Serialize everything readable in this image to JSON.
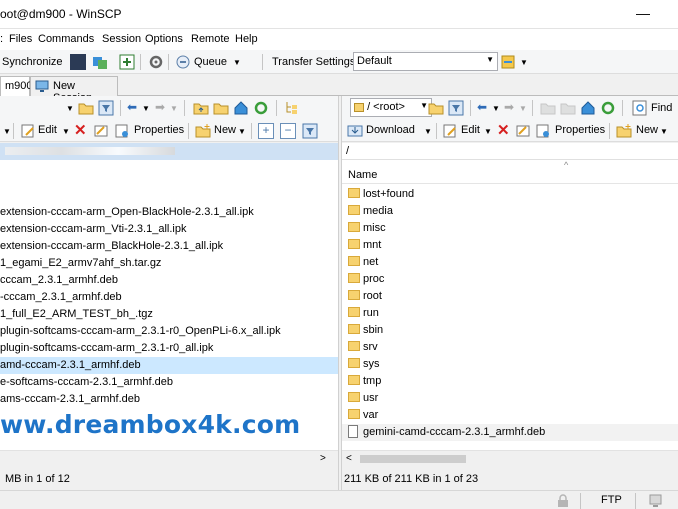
{
  "window": {
    "title": "oot@dm900 - WinSCP",
    "minimize_glyph": "—"
  },
  "menu": [
    "Files",
    "Commands",
    "Session",
    "Options",
    "Remote",
    "Help"
  ],
  "toolbar": {
    "synchronize": "Synchronize",
    "queue": "Queue",
    "transfer_settings_label": "Transfer Settings",
    "transfer_settings_value": "Default"
  },
  "tabs": {
    "session": "m900",
    "new_session": "New Session"
  },
  "left_pane": {
    "edit": "Edit",
    "properties": "Properties",
    "new": "New",
    "files": [
      "",
      "extension-cccam-arm_Open-BlackHole-2.3.1_all.ipk",
      "extension-cccam-arm_Vti-2.3.1_all.ipk",
      "extension-cccam-arm_BlackHole-2.3.1_all.ipk",
      "1_egami_E2_armv7ahf_sh.tar.gz",
      "cccam_2.3.1_armhf.deb",
      "-cccam_2.3.1_armhf.deb",
      "1_full_E2_ARM_TEST_bh_.tgz",
      "plugin-softcams-cccam-arm_2.3.1-r0_OpenPLi-6.x_all.ipk",
      "plugin-softcams-cccam-arm_2.3.1-r0_all.ipk",
      "amd-cccam-2.3.1_armhf.deb",
      "e-softcams-cccam-2.3.1_armhf.deb",
      "ams-cccam-2.3.1_armhf.deb"
    ],
    "status": "MB in 1 of 12"
  },
  "right_pane": {
    "path": "/ <root>",
    "find": "Find",
    "download": "Download",
    "edit": "Edit",
    "properties": "Properties",
    "new": "New",
    "path_display": "/",
    "name_header": "Name",
    "files": [
      {
        "name": "lost+found",
        "type": "folder"
      },
      {
        "name": "media",
        "type": "folder"
      },
      {
        "name": "misc",
        "type": "folder"
      },
      {
        "name": "mnt",
        "type": "folder"
      },
      {
        "name": "net",
        "type": "folder"
      },
      {
        "name": "proc",
        "type": "folder"
      },
      {
        "name": "root",
        "type": "folder"
      },
      {
        "name": "run",
        "type": "folder"
      },
      {
        "name": "sbin",
        "type": "folder"
      },
      {
        "name": "srv",
        "type": "folder"
      },
      {
        "name": "sys",
        "type": "folder"
      },
      {
        "name": "tmp",
        "type": "folder"
      },
      {
        "name": "usr",
        "type": "folder"
      },
      {
        "name": "var",
        "type": "folder"
      },
      {
        "name": "gemini-camd-cccam-2.3.1_armhf.deb",
        "type": "file"
      }
    ],
    "status": "211 KB of 211 KB in 1 of 23"
  },
  "watermark": "ww.dreambox4k.com",
  "statusbar": {
    "protocol": "FTP"
  }
}
